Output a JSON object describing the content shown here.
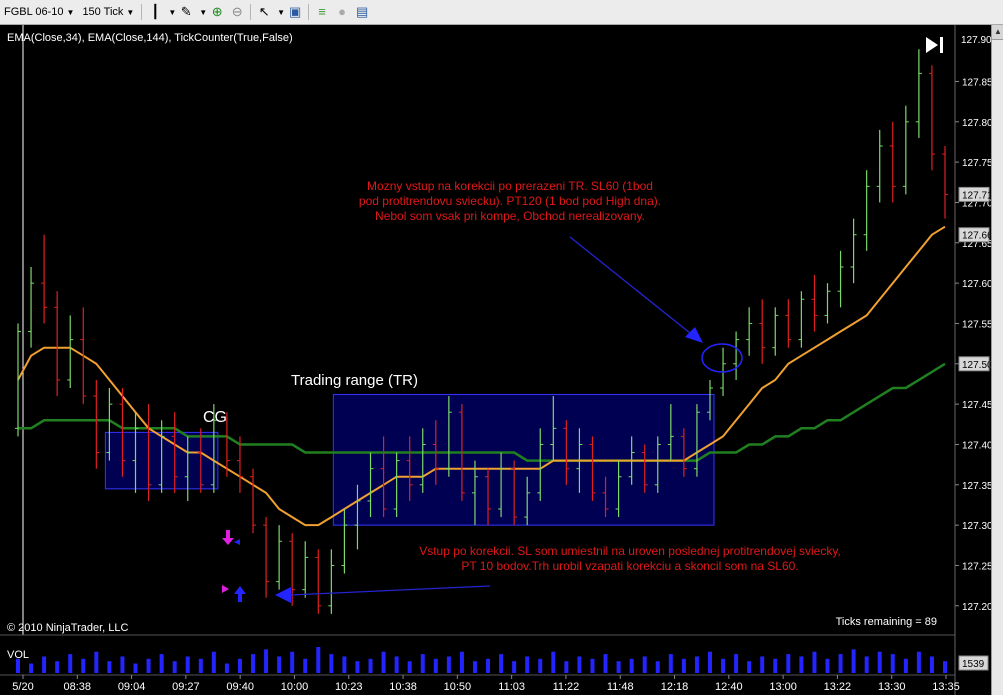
{
  "toolbar": {
    "instrument": "FGBL 06-10",
    "period": "150 Tick",
    "icons": [
      "bar-style-icon",
      "draw-icon",
      "zoom-in-icon",
      "zoom-out-icon",
      "cursor-icon",
      "properties-icon",
      "strategy-icon",
      "circle-icon",
      "data-box-icon"
    ]
  },
  "chart": {
    "indicator_label": "EMA(Close,34), EMA(Close,144), TickCounter(True,False)",
    "copyright": "© 2010 NinjaTrader, LLC",
    "ticks_remaining": "Ticks remaining = 89",
    "vol_label": "VOL",
    "vol_value": "1539",
    "colors": {
      "background": "#000000",
      "up_bar": "#7cd96a",
      "down_bar": "#e02020",
      "ema34": "#f0a030",
      "ema144": "#208020",
      "annotation_text": "#e01818",
      "box_border": "#3434ff",
      "box_fill": "#00006e",
      "price_marker_bg": "#d8d8d8",
      "volume": "#2424ff"
    },
    "annotations": {
      "cg": "CG",
      "trading_range": "Trading range (TR)",
      "note_top": [
        "Mozny vstup na korekcii po prerazeni TR. SL60 (1bod",
        "pod protitrendovu sviecku). PT120 (1 bod pod High dna).",
        "Nebol som vsak pri kompe, Obchod nerealizovany."
      ],
      "note_bottom": [
        "Vstup po korekcii. SL som umiestnil na uroven poslednej protitrendovej sviecky,",
        "PT 10 bodov.Trh urobil vzapati korekciu a skoncil som na SL60."
      ]
    },
    "price_markers": [
      "127.71",
      "127.66",
      "127.50"
    ],
    "top_price_label": "127.90"
  },
  "chart_data": {
    "type": "line",
    "title": "",
    "ylim": [
      127.17,
      127.92
    ],
    "y_ticks": [
      "127.85",
      "127.80",
      "127.75",
      "127.70",
      "127.65",
      "127.60",
      "127.55",
      "127.50",
      "127.45",
      "127.40",
      "127.35",
      "127.30",
      "127.25",
      "127.20"
    ],
    "x_ticks": [
      "5/20",
      "08:38",
      "09:04",
      "09:27",
      "09:40",
      "10:00",
      "10:23",
      "10:38",
      "10:50",
      "11:03",
      "11:22",
      "11:48",
      "12:18",
      "12:40",
      "13:00",
      "13:22",
      "13:30",
      "13:35"
    ],
    "bars": [
      [
        127.42,
        127.55,
        127.41,
        127.54
      ],
      [
        127.54,
        127.62,
        127.52,
        127.6
      ],
      [
        127.6,
        127.66,
        127.55,
        127.57
      ],
      [
        127.57,
        127.59,
        127.46,
        127.48
      ],
      [
        127.48,
        127.56,
        127.47,
        127.53
      ],
      [
        127.53,
        127.57,
        127.45,
        127.46
      ],
      [
        127.46,
        127.48,
        127.37,
        127.39
      ],
      [
        127.39,
        127.47,
        127.38,
        127.45
      ],
      [
        127.45,
        127.47,
        127.36,
        127.38
      ],
      [
        127.38,
        127.44,
        127.34,
        127.42
      ],
      [
        127.42,
        127.45,
        127.33,
        127.35
      ],
      [
        127.35,
        127.43,
        127.34,
        127.41
      ],
      [
        127.41,
        127.44,
        127.34,
        127.36
      ],
      [
        127.36,
        127.41,
        127.33,
        127.39
      ],
      [
        127.39,
        127.42,
        127.34,
        127.35
      ],
      [
        127.35,
        127.45,
        127.34,
        127.43
      ],
      [
        127.43,
        127.44,
        127.36,
        127.38
      ],
      [
        127.38,
        127.41,
        127.34,
        127.36
      ],
      [
        127.36,
        127.37,
        127.29,
        127.3
      ],
      [
        127.3,
        127.31,
        127.21,
        127.23
      ],
      [
        127.23,
        127.3,
        127.22,
        127.28
      ],
      [
        127.28,
        127.29,
        127.2,
        127.22
      ],
      [
        127.22,
        127.28,
        127.21,
        127.26
      ],
      [
        127.26,
        127.27,
        127.19,
        127.2
      ],
      [
        127.2,
        127.27,
        127.19,
        127.25
      ],
      [
        127.25,
        127.32,
        127.24,
        127.3
      ],
      [
        127.3,
        127.35,
        127.27,
        127.33
      ],
      [
        127.33,
        127.39,
        127.31,
        127.37
      ],
      [
        127.37,
        127.41,
        127.31,
        127.32
      ],
      [
        127.32,
        127.39,
        127.31,
        127.38
      ],
      [
        127.38,
        127.41,
        127.33,
        127.35
      ],
      [
        127.35,
        127.42,
        127.34,
        127.4
      ],
      [
        127.4,
        127.43,
        127.35,
        127.37
      ],
      [
        127.37,
        127.46,
        127.36,
        127.44
      ],
      [
        127.44,
        127.45,
        127.33,
        127.34
      ],
      [
        127.34,
        127.38,
        127.3,
        127.36
      ],
      [
        127.36,
        127.37,
        127.3,
        127.32
      ],
      [
        127.32,
        127.39,
        127.31,
        127.37
      ],
      [
        127.37,
        127.38,
        127.3,
        127.31
      ],
      [
        127.31,
        127.36,
        127.3,
        127.34
      ],
      [
        127.34,
        127.42,
        127.33,
        127.4
      ],
      [
        127.4,
        127.46,
        127.38,
        127.42
      ],
      [
        127.42,
        127.43,
        127.35,
        127.37
      ],
      [
        127.37,
        127.42,
        127.34,
        127.4
      ],
      [
        127.4,
        127.41,
        127.33,
        127.34
      ],
      [
        127.34,
        127.36,
        127.31,
        127.32
      ],
      [
        127.32,
        127.38,
        127.31,
        127.36
      ],
      [
        127.36,
        127.41,
        127.35,
        127.39
      ],
      [
        127.39,
        127.4,
        127.34,
        127.35
      ],
      [
        127.35,
        127.41,
        127.34,
        127.4
      ],
      [
        127.4,
        127.45,
        127.38,
        127.41
      ],
      [
        127.41,
        127.42,
        127.36,
        127.37
      ],
      [
        127.37,
        127.45,
        127.36,
        127.44
      ],
      [
        127.44,
        127.48,
        127.43,
        127.47
      ],
      [
        127.47,
        127.52,
        127.46,
        127.5
      ],
      [
        127.5,
        127.54,
        127.48,
        127.53
      ],
      [
        127.53,
        127.57,
        127.51,
        127.55
      ],
      [
        127.55,
        127.58,
        127.5,
        127.52
      ],
      [
        127.52,
        127.57,
        127.51,
        127.56
      ],
      [
        127.56,
        127.58,
        127.52,
        127.53
      ],
      [
        127.53,
        127.59,
        127.52,
        127.58
      ],
      [
        127.58,
        127.61,
        127.54,
        127.56
      ],
      [
        127.56,
        127.6,
        127.55,
        127.59
      ],
      [
        127.59,
        127.64,
        127.57,
        127.62
      ],
      [
        127.62,
        127.68,
        127.6,
        127.66
      ],
      [
        127.66,
        127.74,
        127.64,
        127.72
      ],
      [
        127.72,
        127.79,
        127.7,
        127.77
      ],
      [
        127.77,
        127.8,
        127.7,
        127.72
      ],
      [
        127.72,
        127.82,
        127.71,
        127.8
      ],
      [
        127.8,
        127.89,
        127.78,
        127.86
      ],
      [
        127.86,
        127.87,
        127.74,
        127.76
      ],
      [
        127.76,
        127.77,
        127.68,
        127.71
      ]
    ],
    "series": [
      {
        "name": "EMA(Close,34)",
        "values": [
          127.48,
          127.51,
          127.52,
          127.52,
          127.52,
          127.51,
          127.5,
          127.48,
          127.46,
          127.44,
          127.42,
          127.41,
          127.4,
          127.39,
          127.39,
          127.38,
          127.37,
          127.36,
          127.35,
          127.34,
          127.32,
          127.31,
          127.3,
          127.3,
          127.31,
          127.32,
          127.33,
          127.34,
          127.35,
          127.36,
          127.36,
          127.36,
          127.37,
          127.37,
          127.37,
          127.37,
          127.37,
          127.37,
          127.37,
          127.37,
          127.37,
          127.38,
          127.38,
          127.38,
          127.38,
          127.38,
          127.38,
          127.38,
          127.38,
          127.38,
          127.38,
          127.38,
          127.39,
          127.4,
          127.41,
          127.43,
          127.45,
          127.47,
          127.48,
          127.5,
          127.51,
          127.52,
          127.53,
          127.54,
          127.55,
          127.56,
          127.58,
          127.6,
          127.62,
          127.64,
          127.66,
          127.67
        ]
      },
      {
        "name": "EMA(Close,144)",
        "values": [
          127.42,
          127.42,
          127.43,
          127.43,
          127.43,
          127.43,
          127.43,
          127.43,
          127.42,
          127.42,
          127.42,
          127.42,
          127.42,
          127.41,
          127.41,
          127.41,
          127.41,
          127.4,
          127.4,
          127.4,
          127.4,
          127.4,
          127.39,
          127.39,
          127.39,
          127.39,
          127.39,
          127.39,
          127.39,
          127.39,
          127.39,
          127.39,
          127.39,
          127.39,
          127.39,
          127.39,
          127.39,
          127.39,
          127.39,
          127.38,
          127.38,
          127.38,
          127.38,
          127.38,
          127.38,
          127.38,
          127.38,
          127.38,
          127.38,
          127.38,
          127.38,
          127.38,
          127.38,
          127.39,
          127.39,
          127.39,
          127.4,
          127.4,
          127.41,
          127.41,
          127.42,
          127.42,
          127.43,
          127.43,
          127.44,
          127.45,
          127.46,
          127.47,
          127.47,
          127.48,
          127.49,
          127.5
        ]
      }
    ],
    "volume": [
      6,
      4,
      7,
      5,
      8,
      6,
      9,
      5,
      7,
      4,
      6,
      8,
      5,
      7,
      6,
      9,
      4,
      6,
      8,
      10,
      7,
      9,
      6,
      11,
      8,
      7,
      5,
      6,
      9,
      7,
      5,
      8,
      6,
      7,
      9,
      5,
      6,
      8,
      5,
      7,
      6,
      9,
      5,
      7,
      6,
      8,
      5,
      6,
      7,
      5,
      8,
      6,
      7,
      9,
      6,
      8,
      5,
      7,
      6,
      8,
      7,
      9,
      6,
      8,
      10,
      7,
      9,
      8,
      6,
      9,
      7,
      5
    ],
    "legend": "none",
    "grid": false
  }
}
